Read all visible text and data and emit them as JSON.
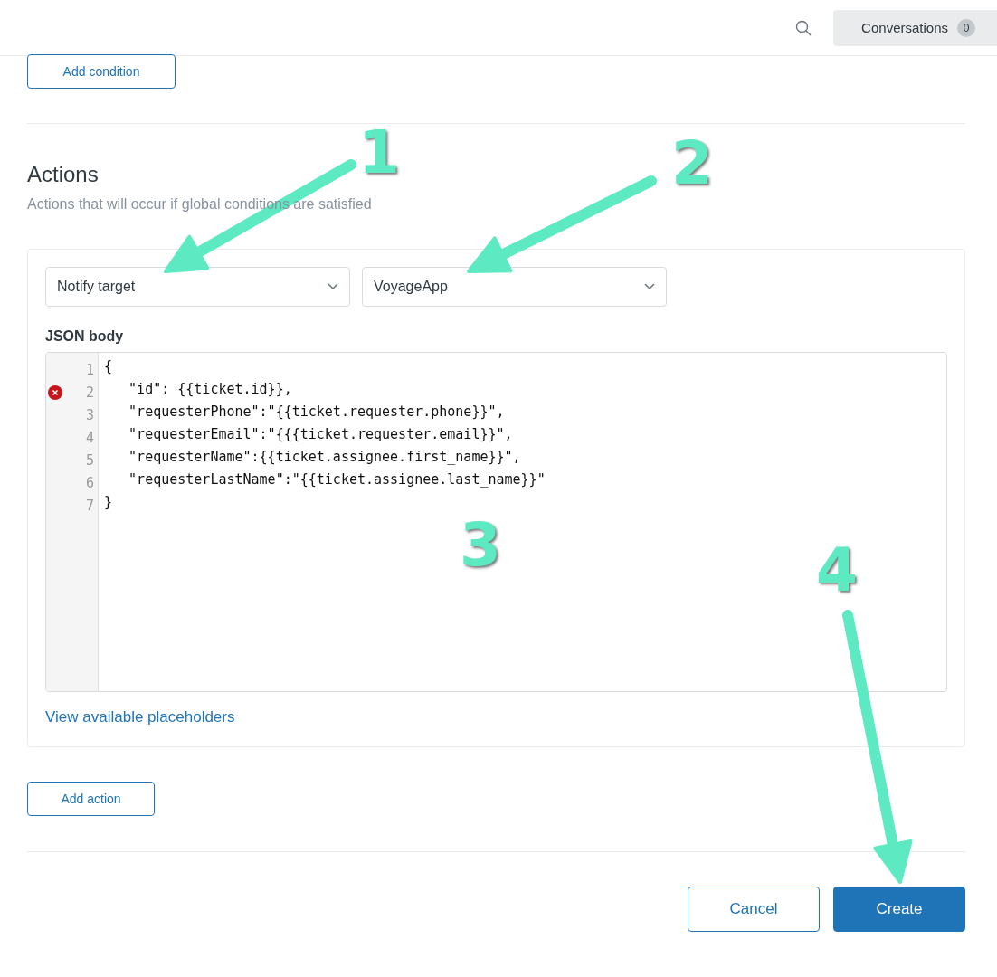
{
  "header": {
    "conversations": {
      "label": "Conversations",
      "count": "0"
    }
  },
  "conditions": {
    "add_button": "Add condition"
  },
  "actions": {
    "title": "Actions",
    "subtitle": "Actions that will occur if global conditions are satisfied",
    "items": [
      {
        "selects": [
          {
            "value": "Notify target"
          },
          {
            "value": "VoyageApp"
          }
        ],
        "body_label": "JSON body",
        "code_lines": [
          {
            "number": "1",
            "text": "{",
            "error": false
          },
          {
            "number": "2",
            "text": "   \"id\": {{ticket.id}},",
            "error": true
          },
          {
            "number": "3",
            "text": "   \"requesterPhone\":\"{{ticket.requester.phone}}\",",
            "error": false
          },
          {
            "number": "4",
            "text": "   \"requesterEmail\":\"{{{ticket.requester.email}}\",",
            "error": false
          },
          {
            "number": "5",
            "text": "   \"requesterName\":{{ticket.assignee.first_name}}\",",
            "error": false
          },
          {
            "number": "6",
            "text": "   \"requesterLastName\":\"{{ticket.assignee.last_name}}\"",
            "error": false
          },
          {
            "number": "7",
            "text": "}",
            "error": false
          }
        ],
        "link": "View available placeholders"
      }
    ],
    "add_button": "Add action"
  },
  "footer": {
    "buttons": [
      {
        "label": "Cancel",
        "kind": "secondary"
      },
      {
        "label": "Create",
        "kind": "primary"
      }
    ]
  },
  "annotations": [
    {
      "label": "1"
    },
    {
      "label": "2"
    },
    {
      "label": "3"
    },
    {
      "label": "4"
    }
  ]
}
